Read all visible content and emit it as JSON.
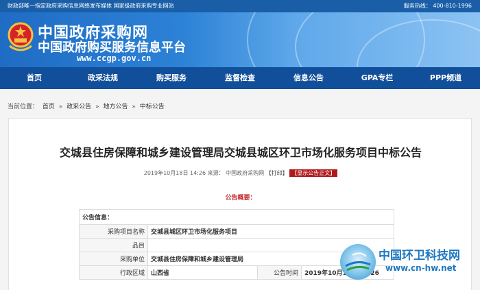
{
  "topbar": {
    "note": "财政部唯一指定政府采购信息网络发布媒体  国家级政府采购专业网站",
    "hotline": "服务热线：  400-810-1996"
  },
  "header": {
    "title": "中国政府采购网",
    "subtitle": "中国政府购买服务信息平台",
    "url": "www.ccgp.gov.cn"
  },
  "nav": {
    "items": [
      "首页",
      "政采法规",
      "购买服务",
      "监督检查",
      "信息公告",
      "GPA专栏",
      "PPP频道"
    ]
  },
  "breadcrumb": {
    "label": "当前位置：",
    "items": [
      "首页",
      "政采公告",
      "地方公告",
      "中标公告"
    ],
    "sep": "»"
  },
  "notice": {
    "title": "交城县住房保障和城乡建设管理局交城县城区环卫市场化服务项目中标公告",
    "date": "2019年10月18日 14:26",
    "source": "来源：",
    "source_name": "中国政府采购网",
    "print": "【打印】",
    "show_full": "【显示公告正文】",
    "summary_label": "公告概要："
  },
  "info_table": {
    "header": "公告信息：",
    "rows": [
      {
        "label": "采购项目名称",
        "value": "交城县城区环卫市场化服务项目"
      },
      {
        "label": "品目",
        "value": ""
      },
      {
        "label": "采购单位",
        "value": "交城县住房保障和城乡建设管理局"
      }
    ],
    "last_row": {
      "label": "行政区域",
      "value": "山西省",
      "label2": "公告时间",
      "value2": "2019年10月18日 14:26"
    }
  },
  "watermark": {
    "name": "中国环卫科技网",
    "url": "www.cn-hw.net"
  },
  "colors": {
    "nav_bg": "#114f9a",
    "accent_red": "#b0191c",
    "watermark_blue": "#1e78c2"
  }
}
